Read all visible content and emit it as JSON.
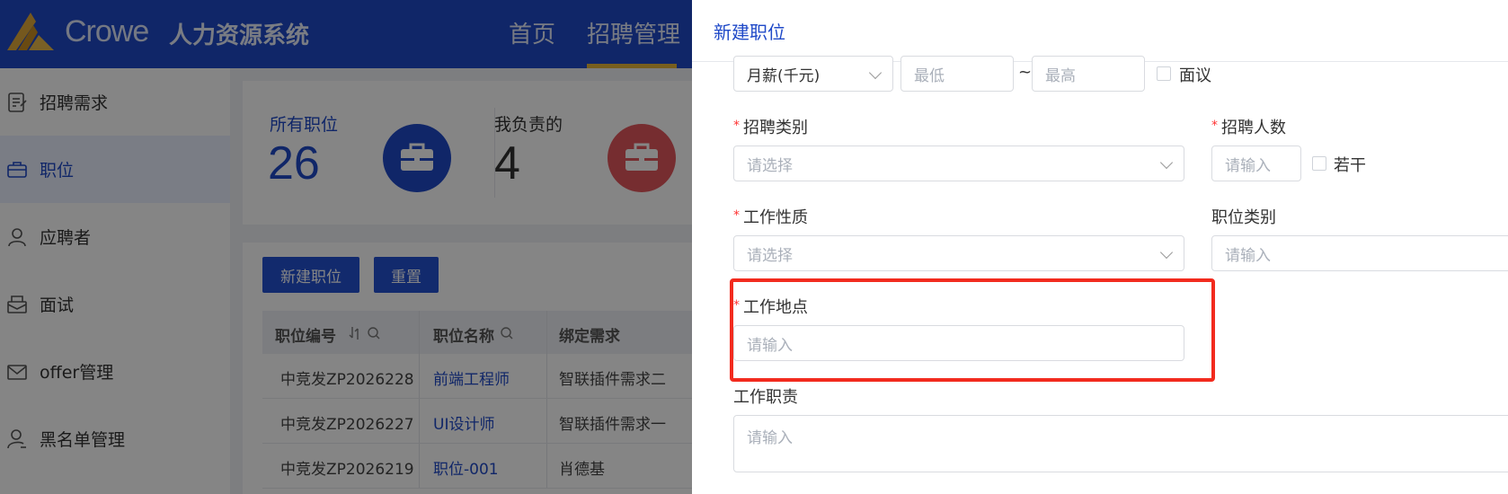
{
  "header": {
    "brand": "Crowe",
    "system_title": "人力资源系统",
    "nav": [
      {
        "label": "首页"
      },
      {
        "label": "招聘管理"
      }
    ],
    "accent_color": "#e4b43a",
    "bar_color": "#1f49c8"
  },
  "sidebar": {
    "items": [
      {
        "label": "招聘需求",
        "icon": "requirements-icon"
      },
      {
        "label": "职位",
        "icon": "briefcase-icon"
      },
      {
        "label": "应聘者",
        "icon": "candidates-icon"
      },
      {
        "label": "面试",
        "icon": "interview-icon"
      },
      {
        "label": "offer管理",
        "icon": "mail-icon"
      },
      {
        "label": "黑名单管理",
        "icon": "blacklist-user-icon"
      }
    ]
  },
  "stats": [
    {
      "label": "所有职位",
      "value": "26",
      "icon": "briefcase-icon",
      "color": "#1f49c8"
    },
    {
      "label": "我负责的",
      "value": "4",
      "icon": "briefcase-icon",
      "color": "#e3575d"
    }
  ],
  "toolbar": {
    "create_label": "新建职位",
    "reset_label": "重置"
  },
  "table": {
    "headers": [
      "职位编号",
      "职位名称",
      "绑定需求"
    ],
    "rows": [
      [
        "中竞发ZP2026228",
        "前端工程师",
        "智联插件需求二"
      ],
      [
        "中竞发ZP2026227",
        "UI设计师",
        "智联插件需求一"
      ],
      [
        "中竞发ZP2026219",
        "职位-001",
        "肖德基"
      ]
    ]
  },
  "drawer": {
    "title": "新建职位",
    "salary": {
      "unit_value": "月薪(千元)",
      "min_placeholder": "最低",
      "separator": "~",
      "max_placeholder": "最高",
      "negotiable_label": "面议"
    },
    "recruit_type": {
      "label": "招聘类别",
      "placeholder": "请选择"
    },
    "headcount": {
      "label": "招聘人数",
      "placeholder": "请输入",
      "several_label": "若干"
    },
    "job_nature": {
      "label": "工作性质",
      "placeholder": "请选择"
    },
    "job_category": {
      "label": "职位类别",
      "placeholder": "请输入"
    },
    "work_location": {
      "label": "工作地点",
      "placeholder": "请输入"
    },
    "duties": {
      "label": "工作职责",
      "placeholder": "请输入"
    },
    "required_mark": "*",
    "highlight_color": "#f22b1e"
  }
}
